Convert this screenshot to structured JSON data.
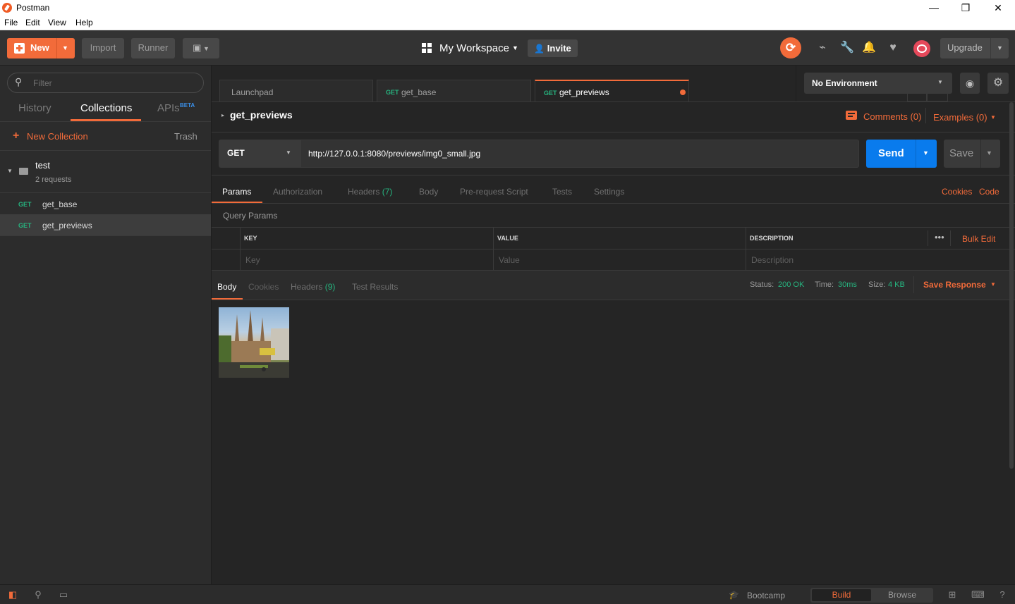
{
  "window": {
    "title": "Postman",
    "minimize": "—",
    "maximize": "❐",
    "close": "✕"
  },
  "menu": [
    "File",
    "Edit",
    "View",
    "Help"
  ],
  "header": {
    "new_label": "New",
    "import_label": "Import",
    "runner_label": "Runner",
    "workspace_label": "My Workspace",
    "invite_label": "Invite",
    "upgrade_label": "Upgrade"
  },
  "sidebar": {
    "filter_placeholder": "Filter",
    "tabs": [
      "History",
      "Collections",
      "APIs"
    ],
    "beta_badge": "BETA",
    "new_collection_label": "New Collection",
    "trash_label": "Trash",
    "collection": {
      "name": "test",
      "count": "2 requests"
    },
    "requests": [
      {
        "method": "GET",
        "name": "get_base"
      },
      {
        "method": "GET",
        "name": "get_previews"
      }
    ]
  },
  "tabs": {
    "launchpad": "Launchpad",
    "items": [
      {
        "method": "GET",
        "name": "get_base"
      },
      {
        "method": "GET",
        "name": "get_previews"
      }
    ]
  },
  "environment": {
    "selected": "No Environment"
  },
  "request": {
    "name": "get_previews",
    "comments_label": "Comments (0)",
    "examples_label": "Examples (0)",
    "method": "GET",
    "url": "http://127.0.0.1:8080/previews/img0_small.jpg",
    "send_label": "Send",
    "save_label": "Save"
  },
  "request_tabs": {
    "params": "Params",
    "authorization": "Authorization",
    "headers": "Headers",
    "headers_count": "(7)",
    "body": "Body",
    "prerequest": "Pre-request Script",
    "tests": "Tests",
    "settings": "Settings",
    "cookies": "Cookies",
    "code": "Code"
  },
  "query_params": {
    "title": "Query Params",
    "col_key": "KEY",
    "col_value": "VALUE",
    "col_description": "DESCRIPTION",
    "bulk_edit": "Bulk Edit",
    "key_placeholder": "Key",
    "value_placeholder": "Value",
    "description_placeholder": "Description"
  },
  "response": {
    "tabs": {
      "body": "Body",
      "cookies": "Cookies",
      "headers": "Headers",
      "headers_count": "(9)",
      "test_results": "Test Results"
    },
    "status_label": "Status:",
    "status_value": "200 OK",
    "time_label": "Time:",
    "time_value": "30ms",
    "size_label": "Size:",
    "size_value": "4 KB",
    "save_response": "Save Response"
  },
  "footer": {
    "bootcamp": "Bootcamp",
    "build": "Build",
    "browse": "Browse"
  },
  "colors": {
    "accent": "#f26b3a",
    "send_blue": "#097bed",
    "method_green": "#26b47f",
    "background": "#252525"
  }
}
